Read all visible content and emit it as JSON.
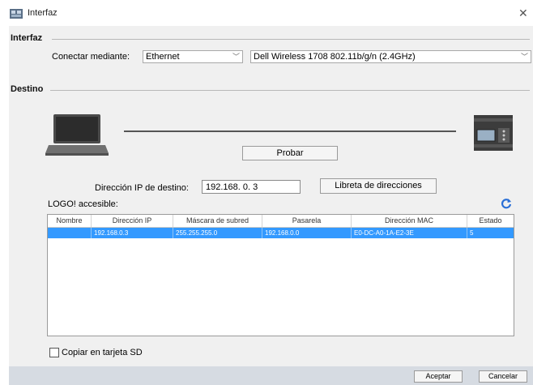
{
  "window": {
    "title": "Interfaz",
    "close_symbol": "✕"
  },
  "interface": {
    "section_label": "Interfaz",
    "connect_label": "Conectar mediante:",
    "connect_value": "Ethernet",
    "adapter_value": "Dell Wireless 1708 802.11b/g/n (2.4GHz)"
  },
  "destination": {
    "section_label": "Destino",
    "test_button": "Probar",
    "ip_label": "Dirección IP de destino:",
    "ip_value": "192.168. 0. 3",
    "address_book_button": "Libreta de direcciones",
    "accessible_label": "LOGO! accesible:"
  },
  "table": {
    "columns": [
      "Nombre",
      "Dirección IP",
      "Máscara de subred",
      "Pasarela",
      "Dirección MAC",
      "Estado"
    ],
    "rows": [
      [
        "",
        "192.168.0.3",
        "255.255.255.0",
        "192.168.0.0",
        "E0-DC-A0-1A-E2-3E",
        "5"
      ]
    ]
  },
  "sd_card": {
    "label": "Copiar en tarjeta SD",
    "checked": false
  },
  "footer": {
    "accept_button": "Aceptar",
    "cancel_button": "Cancelar"
  },
  "colors": {
    "selection": "#3399ff",
    "footer": "#d6dbe2",
    "panel": "#f0f0f0",
    "refresh_icon": "#2a6fd6"
  }
}
